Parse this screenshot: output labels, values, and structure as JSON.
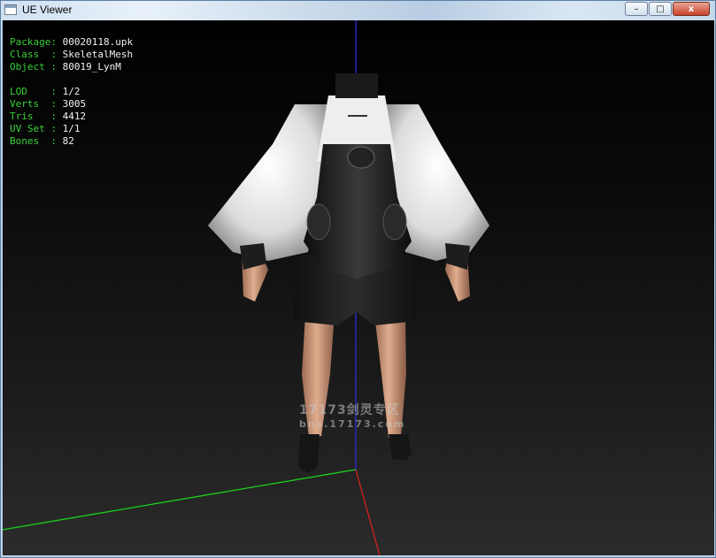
{
  "window": {
    "title": "UE Viewer",
    "minimize": "–",
    "maximize": "□",
    "close": "x"
  },
  "info": {
    "package": {
      "key": "Package:",
      "value": "00020118.upk"
    },
    "class": {
      "key": "Class  :",
      "value": "SkeletalMesh"
    },
    "object": {
      "key": "Object :",
      "value": "80019_LynM"
    },
    "lod": {
      "key": "LOD    :",
      "value": "1/2"
    },
    "verts": {
      "key": "Verts  :",
      "value": "3005"
    },
    "tris": {
      "key": "Tris   :",
      "value": "4412"
    },
    "uvset": {
      "key": "UV Set :",
      "value": "1/1"
    },
    "bones": {
      "key": "Bones  :",
      "value": "82"
    }
  },
  "watermark": {
    "line1": "17173剑灵专区",
    "line2": "bns.17173.com"
  },
  "colors": {
    "axis_x": "#d81f1f",
    "axis_y": "#1bd11b",
    "axis_z": "#2b2bd8",
    "info_key": "#3ad13a",
    "info_value": "#f2f2f2"
  }
}
